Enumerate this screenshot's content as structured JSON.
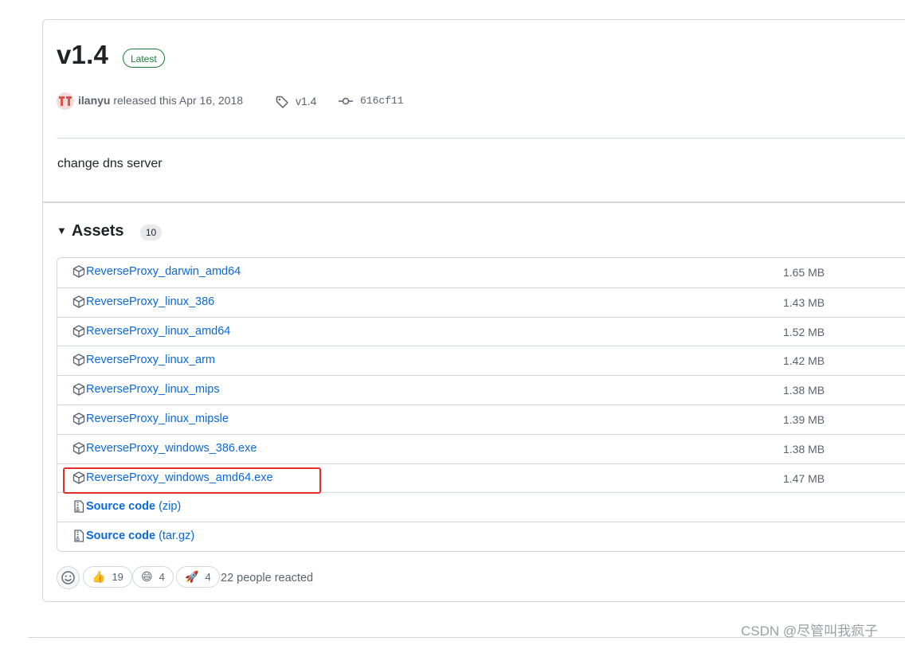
{
  "release": {
    "title": "v1.4",
    "badge": "Latest",
    "author": "ilanyu",
    "released_text": "released this Apr 16, 2018",
    "tag": "v1.4",
    "commit": "616cf11",
    "body": "change dns server"
  },
  "assets": {
    "heading": "Assets",
    "count": "10",
    "items": [
      {
        "name": "ReverseProxy_darwin_amd64",
        "size": "1.65 MB"
      },
      {
        "name": "ReverseProxy_linux_386",
        "size": "1.43 MB"
      },
      {
        "name": "ReverseProxy_linux_amd64",
        "size": "1.52 MB"
      },
      {
        "name": "ReverseProxy_linux_arm",
        "size": "1.42 MB"
      },
      {
        "name": "ReverseProxy_linux_mips",
        "size": "1.38 MB"
      },
      {
        "name": "ReverseProxy_linux_mipsle",
        "size": "1.39 MB"
      },
      {
        "name": "ReverseProxy_windows_386.exe",
        "size": "1.38 MB"
      },
      {
        "name": "ReverseProxy_windows_amd64.exe",
        "size": "1.47 MB"
      }
    ],
    "source": [
      {
        "label": "Source code",
        "format": "(zip)"
      },
      {
        "label": "Source code",
        "format": "(tar.gz)"
      }
    ]
  },
  "reactions": {
    "items": [
      {
        "emoji": "👍",
        "count": "19"
      },
      {
        "emoji": "😄",
        "count": "4"
      },
      {
        "emoji": "🚀",
        "count": "4"
      }
    ],
    "summary": "22 people reacted"
  },
  "watermark": "CSDN @尽管叫我疯子",
  "colors": {
    "link": "#0969da",
    "latest": "#1a7f37",
    "highlight": "#e42c2c",
    "muted": "#59636e"
  }
}
